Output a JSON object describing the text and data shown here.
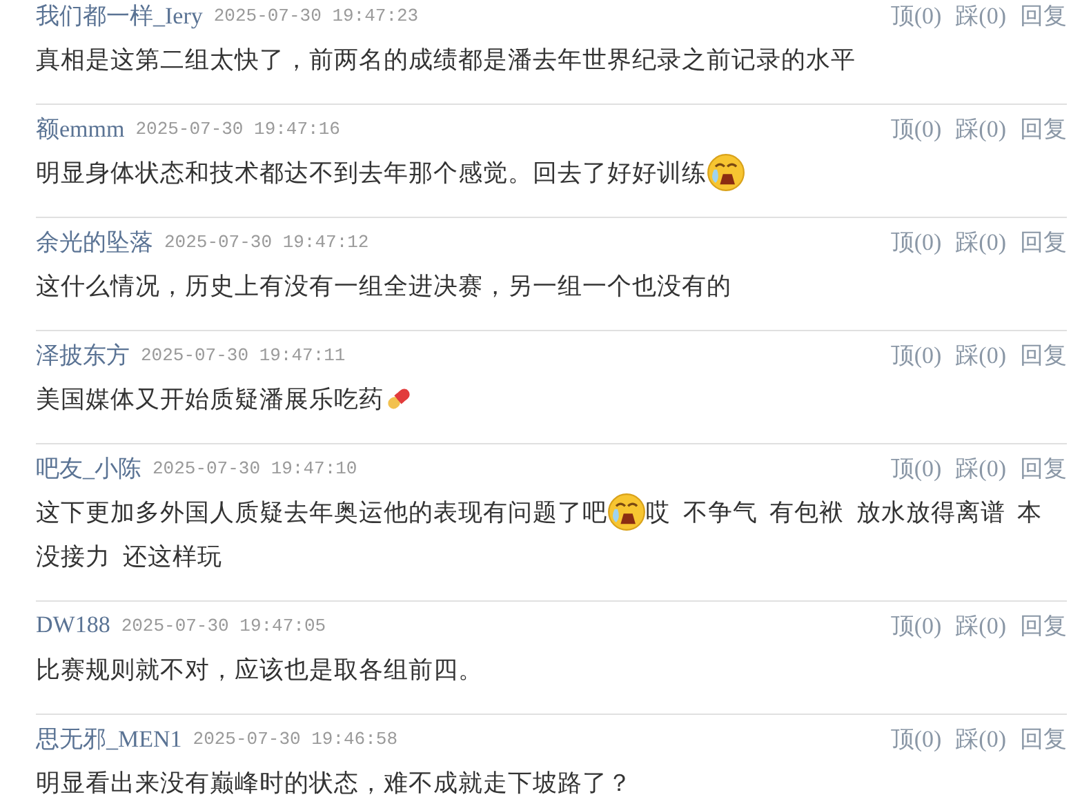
{
  "comments": [
    {
      "user": "我们都一样_Iery",
      "time": "2025-07-30 19:47:23",
      "actions": [
        "顶(0)",
        "踩(0)",
        "回复"
      ],
      "body": [
        {
          "kind": "text",
          "text": "真相是这第二组太快了，前两名的成绩都是潘去年世界纪录之前记录的水平"
        }
      ]
    },
    {
      "user": "额emmm",
      "time": "2025-07-30 19:47:16",
      "actions": [
        "顶(0)",
        "踩(0)",
        "回复"
      ],
      "body": [
        {
          "kind": "text",
          "text": "明显身体状态和技术都达不到去年那个感觉。回去了好好训练"
        },
        {
          "kind": "cry"
        }
      ]
    },
    {
      "user": "余光的坠落",
      "time": "2025-07-30 19:47:12",
      "actions": [
        "顶(0)",
        "踩(0)",
        "回复"
      ],
      "body": [
        {
          "kind": "text",
          "text": "这什么情况，历史上有没有一组全进决赛，另一组一个也没有的"
        }
      ]
    },
    {
      "user": "泽披东方",
      "time": "2025-07-30 19:47:11",
      "actions": [
        "顶(0)",
        "踩(0)",
        "回复"
      ],
      "body": [
        {
          "kind": "text",
          "text": "美国媒体又开始质疑潘展乐吃药"
        },
        {
          "kind": "pill"
        }
      ]
    },
    {
      "user": "吧友_小陈",
      "time": "2025-07-30 19:47:10",
      "actions": [
        "顶(0)",
        "踩(0)",
        "回复"
      ],
      "body": [
        {
          "kind": "text",
          "text": "这下更加多外国人质疑去年奥运他的表现有问题了吧"
        },
        {
          "kind": "cry"
        },
        {
          "kind": "text",
          "text": "哎  不争气  有包袱  放水放得离谱  本"
        },
        {
          "kind": "text",
          "text": "没接力  还这样玩"
        }
      ]
    },
    {
      "user": "DW188",
      "time": "2025-07-30 19:47:05",
      "actions": [
        "顶(0)",
        "踩(0)",
        "回复"
      ],
      "body": [
        {
          "kind": "text",
          "text": "比赛规则就不对，应该也是取各组前四。"
        }
      ]
    },
    {
      "user": "思无邪_MEN1",
      "time": "2025-07-30 19:46:58",
      "actions": [
        "顶(0)",
        "踩(0)",
        "回复"
      ],
      "body": [
        {
          "kind": "text",
          "text": "明显看出来没有巅峰时的状态，难不成就走下坡路了？"
        }
      ]
    }
  ]
}
